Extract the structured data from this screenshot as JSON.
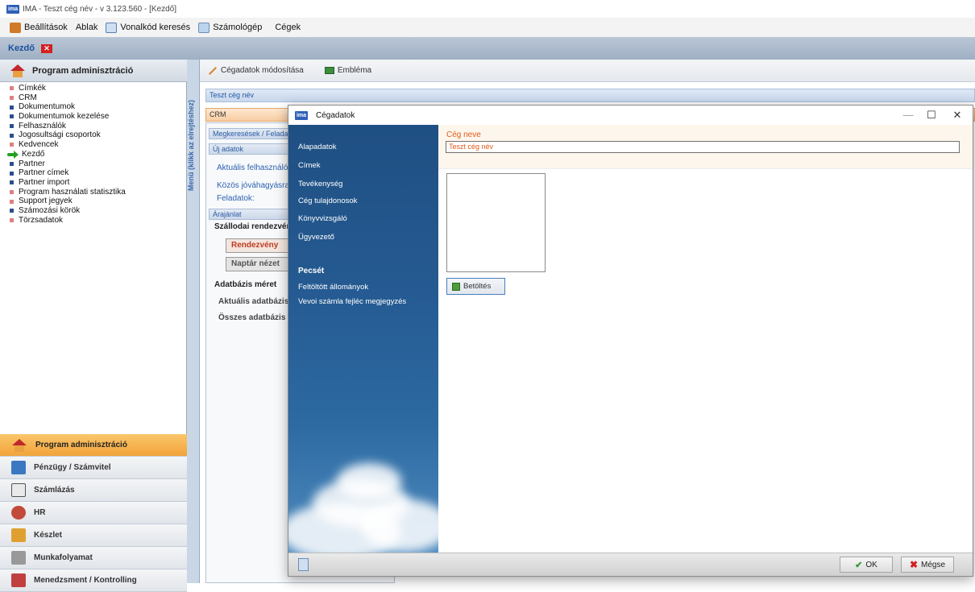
{
  "window": {
    "title": "IMA - Teszt cég név - v 3.123.560 - [Kezdő]",
    "logo": "ima"
  },
  "menubar": {
    "items": [
      {
        "label": "Beállítások",
        "icon": "settings-icon"
      },
      {
        "label": "Ablak",
        "icon": ""
      },
      {
        "label": "Vonalkód keresés",
        "icon": "barcode-icon"
      },
      {
        "label": "Számológép",
        "icon": "calculator-icon"
      },
      {
        "label": "Cégek",
        "icon": ""
      }
    ]
  },
  "tabs": {
    "active": "Kezdő"
  },
  "left_panel": {
    "header": "Program adminisztráció",
    "tree": [
      {
        "label": "Címkék",
        "bullet": "red"
      },
      {
        "label": "CRM",
        "bullet": "red"
      },
      {
        "label": "Dokumentumok",
        "bullet": "blue"
      },
      {
        "label": "Dokumentumok kezelése",
        "bullet": "blue"
      },
      {
        "label": "Felhasználók",
        "bullet": "blue"
      },
      {
        "label": "Jogosultsági csoportok",
        "bullet": "blue"
      },
      {
        "label": "Kedvencek",
        "bullet": "red"
      },
      {
        "label": "Kezdő",
        "bullet": "arrow"
      },
      {
        "label": "Partner",
        "bullet": "blue"
      },
      {
        "label": "Partner címek",
        "bullet": "blue"
      },
      {
        "label": "Partner import",
        "bullet": "blue"
      },
      {
        "label": "Program használati statisztika",
        "bullet": "red"
      },
      {
        "label": "Support jegyek",
        "bullet": "red"
      },
      {
        "label": "Számozási körök",
        "bullet": "blue"
      },
      {
        "label": "Törzsadatok",
        "bullet": "red"
      }
    ],
    "modules": [
      {
        "label": "Program adminisztráció",
        "active": true,
        "color": "#c0282a"
      },
      {
        "label": "Pénzügy / Számvitel",
        "active": false,
        "color": "#3a78c2"
      },
      {
        "label": "Számlázás",
        "active": false,
        "color": "#555555"
      },
      {
        "label": "HR",
        "active": false,
        "color": "#c24a3a"
      },
      {
        "label": "Készlet",
        "active": false,
        "color": "#e0a030"
      },
      {
        "label": "Munkafolyamat",
        "active": false,
        "color": "#888888"
      },
      {
        "label": "Menedzsment / Kontrolling",
        "active": false,
        "color": "#c04040"
      }
    ],
    "vertical_label": "Menü (klikk az elrejtéshez)"
  },
  "main": {
    "toolbar": {
      "edit_label": "Cégadatok módosítása",
      "emblem_label": "Embléma"
    },
    "company_bar": "Teszt cég név",
    "crm_bar": "CRM",
    "section_bars": [
      "Megkeresések / Feladatok",
      "Új adatok",
      "Árajánlat"
    ],
    "links": [
      "Aktuális felhasználó",
      "Közös jóváhagyásra",
      "Feladatok:"
    ],
    "hotel_title": "Szállodai rendezvények",
    "buttons": {
      "event": "Rendezvény",
      "calendar": "Naptár nézet"
    },
    "db_title": "Adatbázis méret",
    "db_rows": [
      "Aktuális adatbázis",
      "Összes adatbázis méret"
    ]
  },
  "dialog": {
    "title": "Cégadatok",
    "nav": [
      "Alapadatok",
      "Címek",
      "Tevékenység",
      "Cég tulajdonosok",
      "Könyvvizsgáló",
      "Ügyvezető"
    ],
    "nav_section": "Pecsét",
    "nav2": [
      "Feltöltött állományok",
      "Vevoi számla fejléc megjegyzés"
    ],
    "field_label": "Cég neve",
    "field_value": "Teszt cég név",
    "load_button": "Betöltés",
    "ok_button": "OK",
    "cancel_button": "Mégse"
  }
}
